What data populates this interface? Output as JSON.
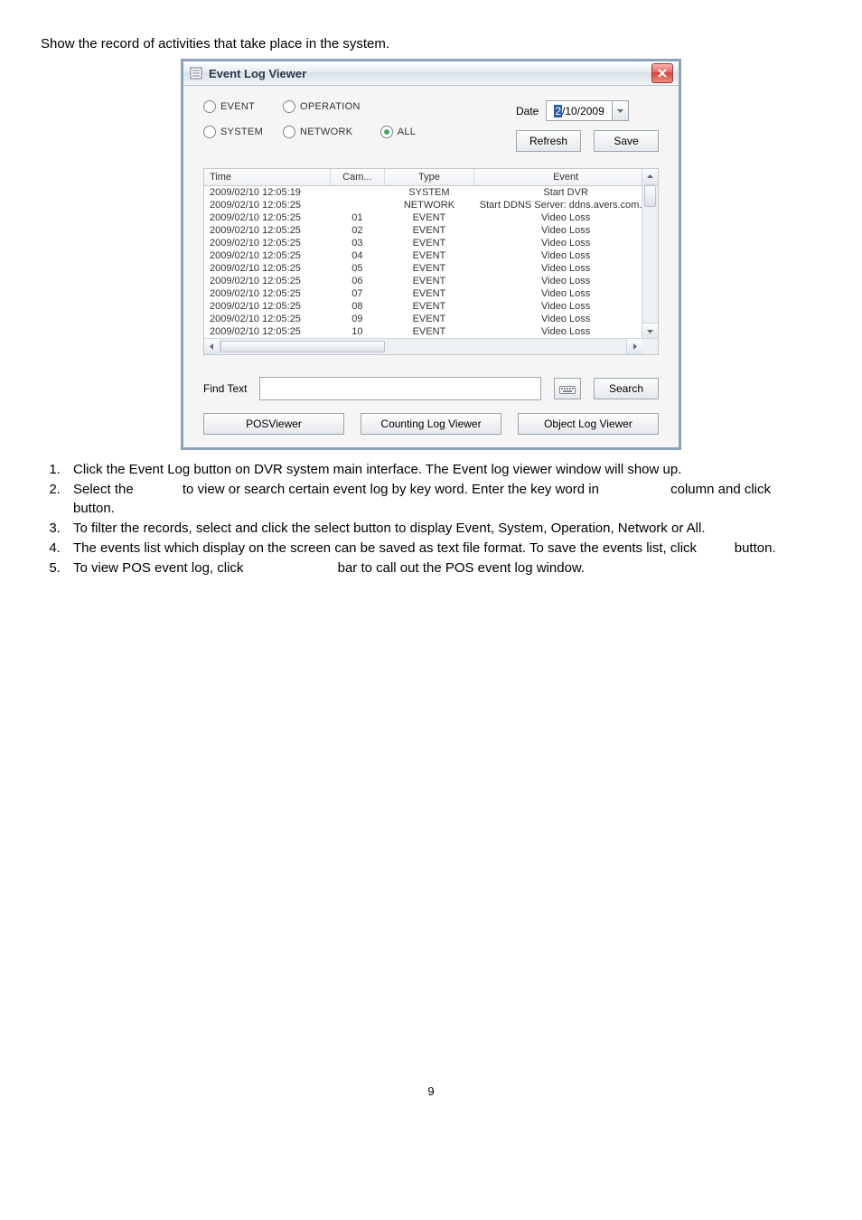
{
  "intro": "Show the record of activities that take place in the system.",
  "window": {
    "title": "Event Log Viewer",
    "filters": {
      "event": "EVENT",
      "operation": "OPERATION",
      "system": "SYSTEM",
      "network": "NETWORK",
      "all": "ALL"
    },
    "date_label": "Date",
    "date_value_prefix": "2",
    "date_value_rest": "/10/2009",
    "refresh": "Refresh",
    "save": "Save",
    "columns": {
      "time": "Time",
      "cam": "Cam...",
      "type": "Type",
      "event": "Event"
    },
    "rows": [
      {
        "time": "2009/02/10 12:05:19",
        "cam": "",
        "type": "SYSTEM",
        "event": "Start DVR"
      },
      {
        "time": "2009/02/10 12:05:25",
        "cam": "",
        "type": "NETWORK",
        "event": "Start DDNS Server: ddns.avers.com.tw"
      },
      {
        "time": "2009/02/10 12:05:25",
        "cam": "01",
        "type": "EVENT",
        "event": "Video Loss"
      },
      {
        "time": "2009/02/10 12:05:25",
        "cam": "02",
        "type": "EVENT",
        "event": "Video Loss"
      },
      {
        "time": "2009/02/10 12:05:25",
        "cam": "03",
        "type": "EVENT",
        "event": "Video Loss"
      },
      {
        "time": "2009/02/10 12:05:25",
        "cam": "04",
        "type": "EVENT",
        "event": "Video Loss"
      },
      {
        "time": "2009/02/10 12:05:25",
        "cam": "05",
        "type": "EVENT",
        "event": "Video Loss"
      },
      {
        "time": "2009/02/10 12:05:25",
        "cam": "06",
        "type": "EVENT",
        "event": "Video Loss"
      },
      {
        "time": "2009/02/10 12:05:25",
        "cam": "07",
        "type": "EVENT",
        "event": "Video Loss"
      },
      {
        "time": "2009/02/10 12:05:25",
        "cam": "08",
        "type": "EVENT",
        "event": "Video Loss"
      },
      {
        "time": "2009/02/10 12:05:25",
        "cam": "09",
        "type": "EVENT",
        "event": "Video Loss"
      },
      {
        "time": "2009/02/10 12:05:25",
        "cam": "10",
        "type": "EVENT",
        "event": "Video Loss"
      }
    ],
    "find_label": "Find Text",
    "search": "Search",
    "posviewer": "POSViewer",
    "counting": "Counting Log Viewer",
    "objectlog": "Object Log Viewer"
  },
  "steps": [
    "Click the Event Log button on DVR system main interface. The Event log viewer window will show up.",
    "Select the             to view or search certain event log by key word. Enter the key word in                   column and click             button.",
    "To filter the records, select and click the select button to display Event, System, Operation, Network or All.",
    "The events list which display on the screen can be saved as text file format. To save the events list, click          button.",
    "To view POS event log, click                         bar to call out the POS event log window."
  ],
  "page_number": "9"
}
